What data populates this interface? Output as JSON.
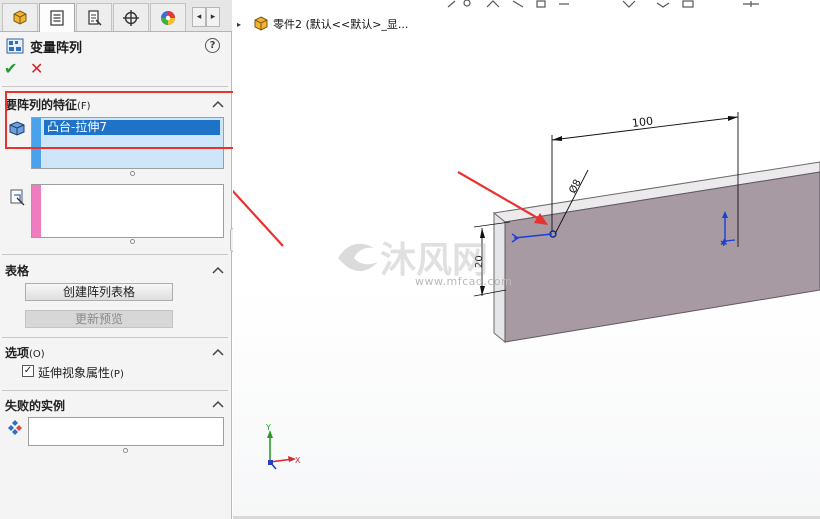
{
  "property_manager": {
    "title": "变量阵列",
    "help": "?",
    "ok": "✔",
    "cancel": "✕",
    "tab_arrow_left": "◂",
    "tab_arrow_right": "▸",
    "features_section": {
      "title": "要阵列的特征",
      "shortcut": "(F)",
      "selected_item": "凸台-拉伸7"
    },
    "table_section": {
      "title": "表格",
      "create_button": "创建阵列表格",
      "update_button": "更新预览"
    },
    "options_section": {
      "title": "选项",
      "shortcut": "(O)",
      "checkbox_label": "延伸视象属性",
      "checkbox_shortcut": "(P)",
      "checked": true,
      "check_mark": "✓"
    },
    "failed_section": {
      "title": "失败的实例"
    }
  },
  "viewport": {
    "tree_arrow": "▸",
    "tree_root": "零件2 (默认<<默认>_显...",
    "dimension_length": "100",
    "dimension_diameter": "Ø8",
    "dimension_height": "20",
    "watermark_main": "沐风网",
    "watermark_url": "www.mfcad.com",
    "triad_x": "X",
    "triad_y": "Y",
    "colors": {
      "part_face": "#a89aa3",
      "annotation_red": "#e8322d",
      "highlight_box": "#e8322d",
      "selection_blue": "#1e73c8",
      "list_bar_blue": "#4aa3ea",
      "list_bar_pink": "#f07bbf"
    }
  }
}
